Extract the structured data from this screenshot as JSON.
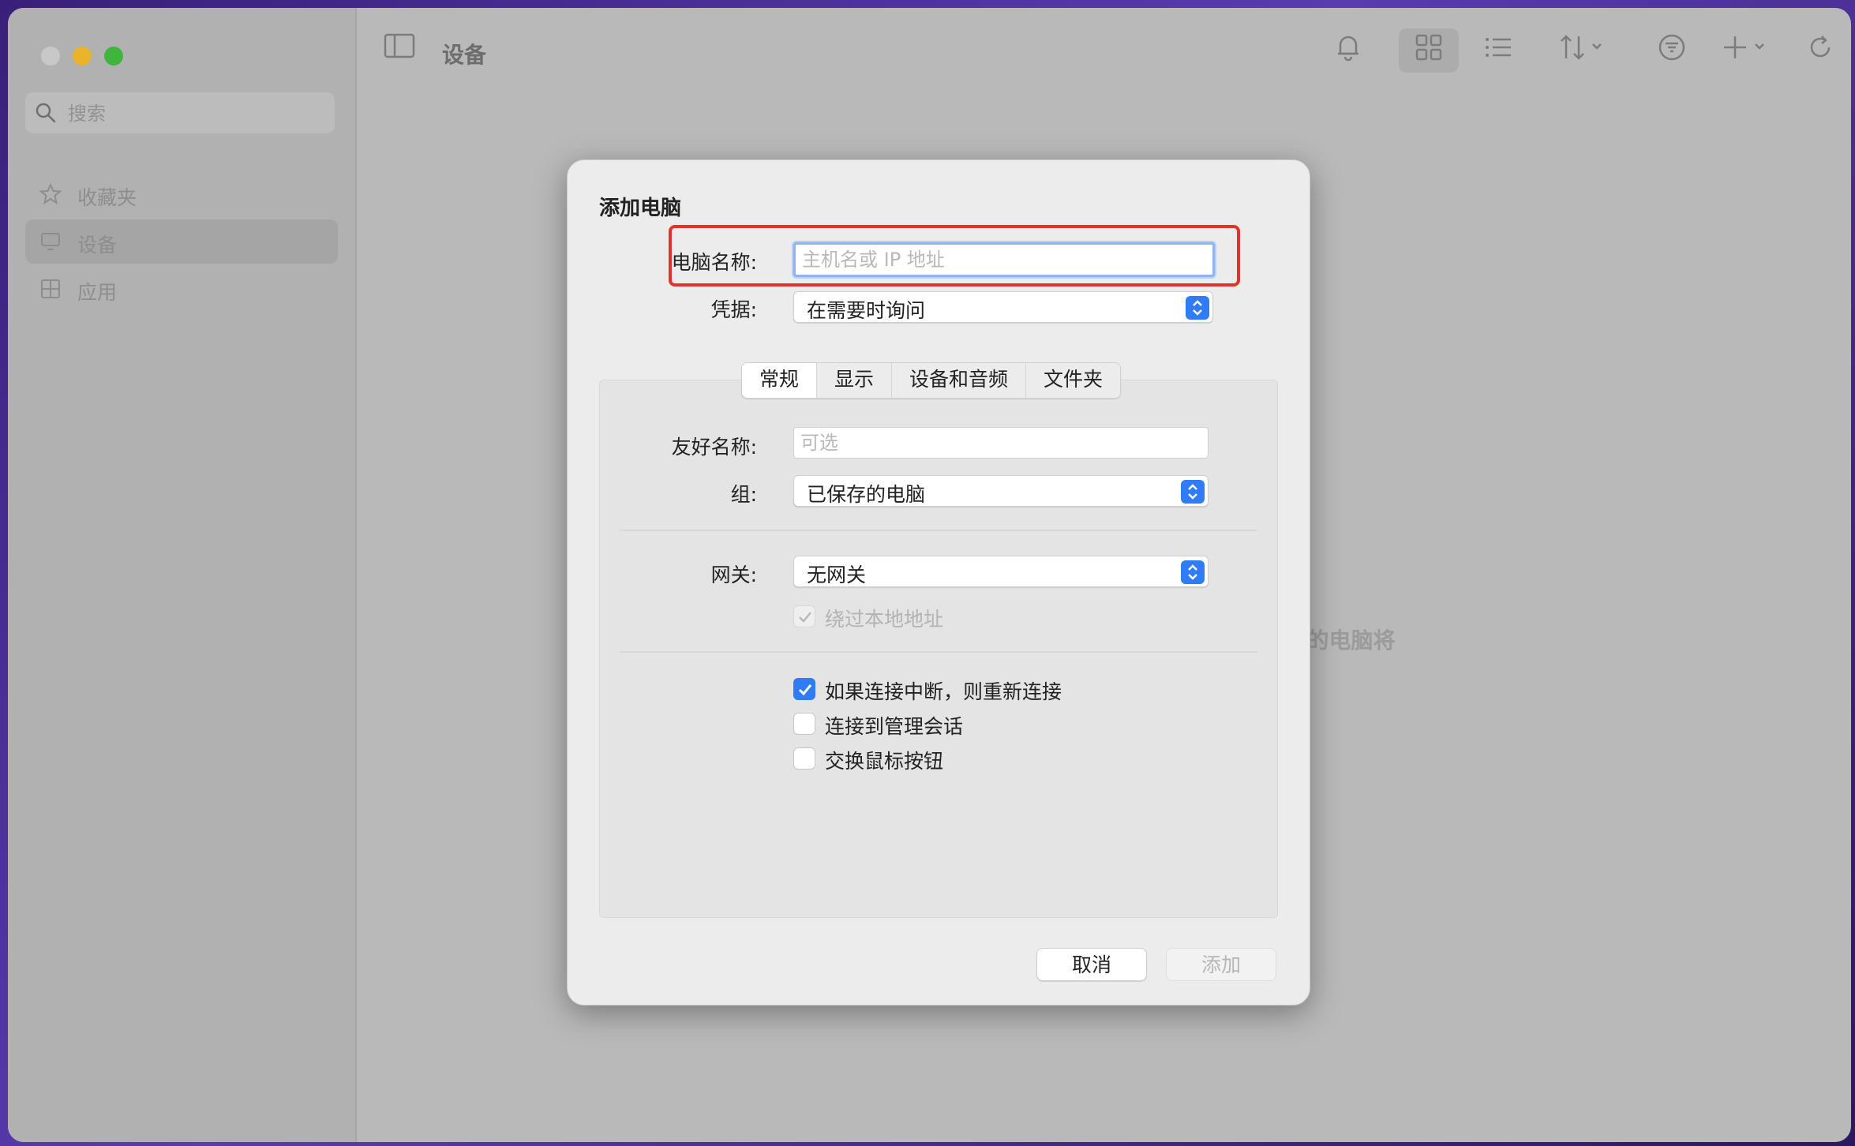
{
  "toolbar": {
    "title": "设备"
  },
  "sidebar": {
    "search_placeholder": "搜索",
    "items": [
      {
        "label": "收藏夹",
        "icon": "star-icon"
      },
      {
        "label": "设备",
        "icon": "monitor-icon",
        "selected": true
      },
      {
        "label": "应用",
        "icon": "apps-icon"
      }
    ]
  },
  "background": {
    "hint_fragment": "P的电脑将"
  },
  "dialog": {
    "title": "添加电脑",
    "pc_name": {
      "label": "电脑名称:",
      "placeholder": "主机名或 IP 地址",
      "value": ""
    },
    "credentials": {
      "label": "凭据:",
      "value": "在需要时询问"
    },
    "tabs": [
      "常规",
      "显示",
      "设备和音频",
      "文件夹"
    ],
    "selected_tab": "常规",
    "friendly_name": {
      "label": "友好名称:",
      "placeholder": "可选",
      "value": ""
    },
    "group": {
      "label": "组:",
      "value": "已保存的电脑"
    },
    "gateway": {
      "label": "网关:",
      "value": "无网关"
    },
    "bypass_local": {
      "label": "绕过本地地址",
      "checked": true,
      "disabled": true
    },
    "checkboxes": [
      {
        "label": "如果连接中断，则重新连接",
        "checked": true
      },
      {
        "label": "连接到管理会话",
        "checked": false
      },
      {
        "label": "交换鼠标按钮",
        "checked": false
      }
    ],
    "cancel_label": "取消",
    "add_label": "添加"
  },
  "colors": {
    "accent": "#2f7cf6",
    "highlight": "#e0332b"
  }
}
